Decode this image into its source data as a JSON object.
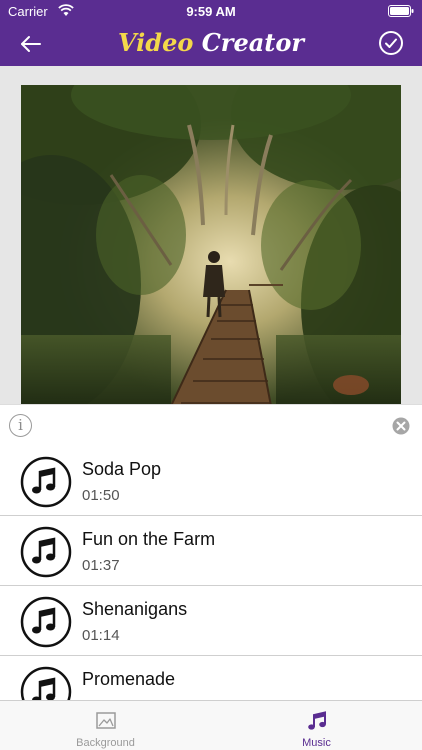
{
  "status_bar": {
    "carrier": "Carrier",
    "time": "9:59 AM"
  },
  "nav": {
    "title_word1": "Video",
    "title_word2": "Creator",
    "back_icon": "arrow-left-icon",
    "done_icon": "checkmark-circle-icon"
  },
  "colors": {
    "brand_purple": "#5a2d91",
    "title_yellow": "#f3d84a"
  },
  "preview": {
    "image_subject": "person on wooden rope bridge in tropical forest"
  },
  "sheet": {
    "info_label": "i",
    "tracks": [
      {
        "title": "Soda Pop",
        "duration": "01:50"
      },
      {
        "title": "Fun on the Farm",
        "duration": "01:37"
      },
      {
        "title": "Shenanigans",
        "duration": "01:14"
      },
      {
        "title": "Promenade",
        "duration": ""
      }
    ]
  },
  "tabs": [
    {
      "label": "Background",
      "icon": "image-icon",
      "selected": false
    },
    {
      "label": "Music",
      "icon": "music-note-icon",
      "selected": true
    }
  ]
}
